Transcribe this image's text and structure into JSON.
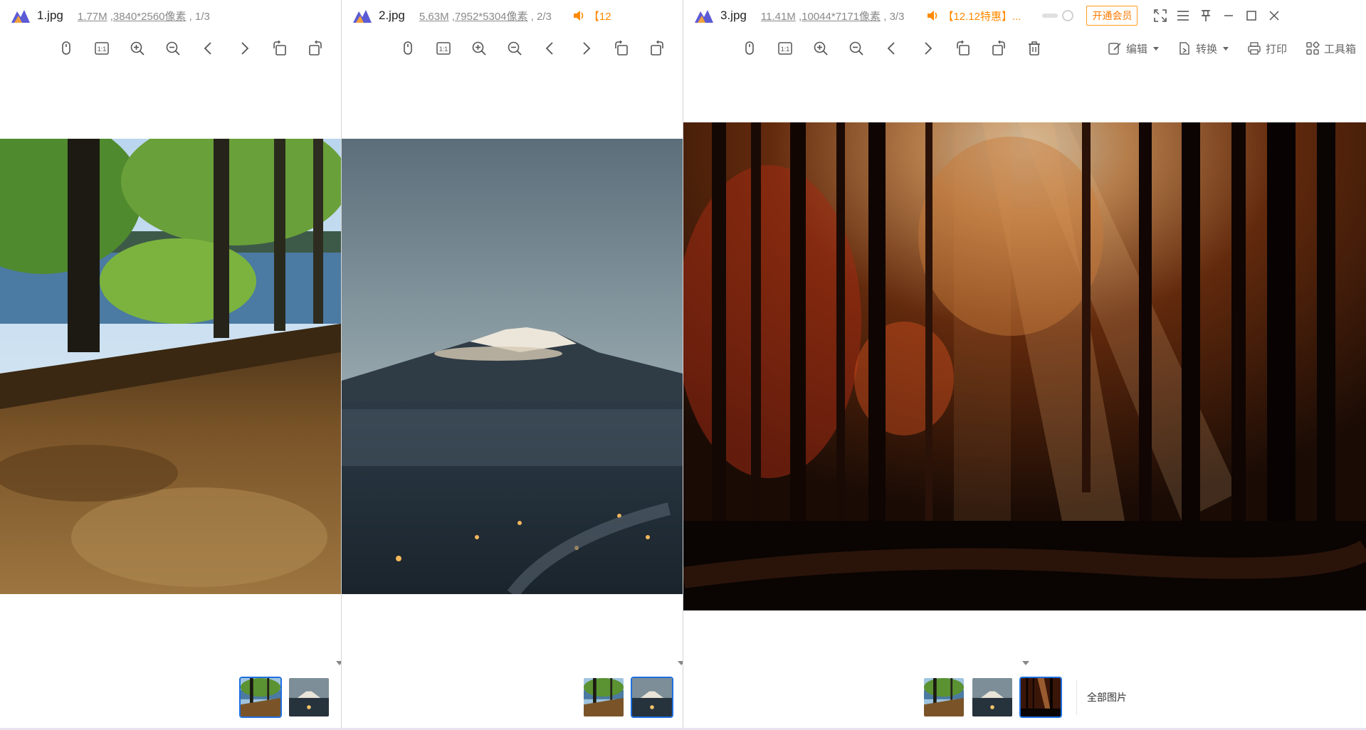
{
  "windows": [
    {
      "filename": "1.jpg",
      "filesize": "1.77M",
      "dimensions": "3840*2560像素",
      "position": "1/3",
      "photo_subject": "forest floor with pine needles and lake"
    },
    {
      "filename": "2.jpg",
      "filesize": "5.63M",
      "dimensions": "7952*5304像素",
      "position": "2/3",
      "promo_partial": "【12",
      "photo_subject": "Mount Fuji above town at dusk"
    },
    {
      "filename": "3.jpg",
      "filesize": "11.41M",
      "dimensions": "10044*7171像素",
      "position": "3/3",
      "promo": "【12.12特惠】...",
      "vip_button": "开通会员",
      "photo_subject": "autumn forest with sunbeams"
    }
  ],
  "toolbar": {
    "edit_label": "编辑",
    "convert_label": "转换",
    "print_label": "打印",
    "toolbox_label": "工具箱",
    "actual_size_label": "1:1"
  },
  "thumbstrip": {
    "all_pictures_label": "全部图片"
  },
  "colors": {
    "accent": "#1e6fe0",
    "promo": "#ff8a00",
    "icon": "#555555",
    "meta_text": "#8a8a8a"
  }
}
